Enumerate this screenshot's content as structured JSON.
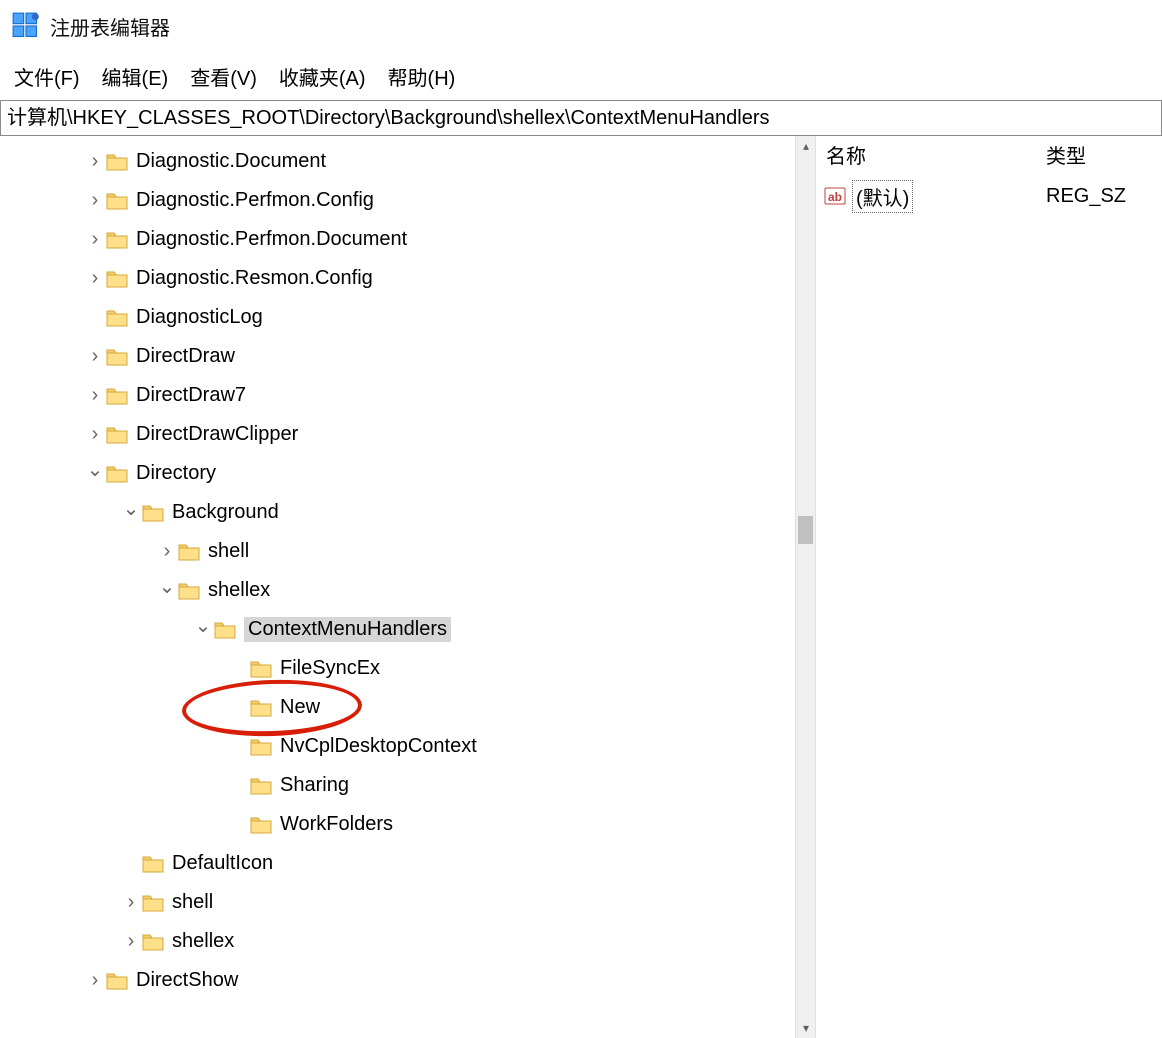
{
  "app": {
    "title": "注册表编辑器"
  },
  "menu": {
    "file": "文件(F)",
    "edit": "编辑(E)",
    "view": "查看(V)",
    "favorites": "收藏夹(A)",
    "help": "帮助(H)"
  },
  "address": "计算机\\HKEY_CLASSES_ROOT\\Directory\\Background\\shellex\\ContextMenuHandlers",
  "values_header": {
    "name": "名称",
    "type": "类型"
  },
  "values_row": {
    "name": "(默认)",
    "type": "REG_SZ"
  },
  "tree": [
    {
      "indent": 1,
      "exp": ">",
      "label": "Diagnostic.Document"
    },
    {
      "indent": 1,
      "exp": ">",
      "label": "Diagnostic.Perfmon.Config"
    },
    {
      "indent": 1,
      "exp": ">",
      "label": "Diagnostic.Perfmon.Document"
    },
    {
      "indent": 1,
      "exp": ">",
      "label": "Diagnostic.Resmon.Config"
    },
    {
      "indent": 1,
      "exp": "",
      "label": "DiagnosticLog"
    },
    {
      "indent": 1,
      "exp": ">",
      "label": "DirectDraw"
    },
    {
      "indent": 1,
      "exp": ">",
      "label": "DirectDraw7"
    },
    {
      "indent": 1,
      "exp": ">",
      "label": "DirectDrawClipper"
    },
    {
      "indent": 1,
      "exp": "v",
      "label": "Directory"
    },
    {
      "indent": 2,
      "exp": "v",
      "label": "Background"
    },
    {
      "indent": 3,
      "exp": ">",
      "label": "shell"
    },
    {
      "indent": 3,
      "exp": "v",
      "label": "shellex"
    },
    {
      "indent": 4,
      "exp": "v",
      "label": "ContextMenuHandlers",
      "selected": true
    },
    {
      "indent": 5,
      "exp": "",
      "label": "FileSyncEx"
    },
    {
      "indent": 5,
      "exp": "",
      "label": "New",
      "circled": true
    },
    {
      "indent": 5,
      "exp": "",
      "label": "NvCplDesktopContext"
    },
    {
      "indent": 5,
      "exp": "",
      "label": "Sharing"
    },
    {
      "indent": 5,
      "exp": "",
      "label": "WorkFolders"
    },
    {
      "indent": 2,
      "exp": "",
      "label": "DefaultIcon"
    },
    {
      "indent": 2,
      "exp": ">",
      "label": "shell"
    },
    {
      "indent": 2,
      "exp": ">",
      "label": "shellex"
    },
    {
      "indent": 1,
      "exp": ">",
      "label": "DirectShow"
    }
  ]
}
